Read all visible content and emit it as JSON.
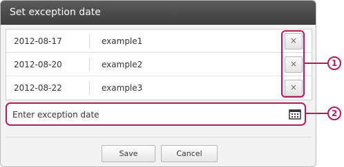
{
  "dialog": {
    "title": "Set exception date"
  },
  "exceptions": [
    {
      "date": "2012-08-17",
      "name": "example1",
      "delete_label": "×"
    },
    {
      "date": "2012-08-20",
      "name": "example2",
      "delete_label": "×"
    },
    {
      "date": "2012-08-22",
      "name": "example3",
      "delete_label": "×"
    }
  ],
  "input": {
    "placeholder": "Enter exception date"
  },
  "buttons": {
    "save": "Save",
    "cancel": "Cancel"
  },
  "callouts": {
    "one": "1",
    "two": "2"
  },
  "colors": {
    "callout": "#b5195b",
    "titlebar": "#4a4a4a"
  }
}
